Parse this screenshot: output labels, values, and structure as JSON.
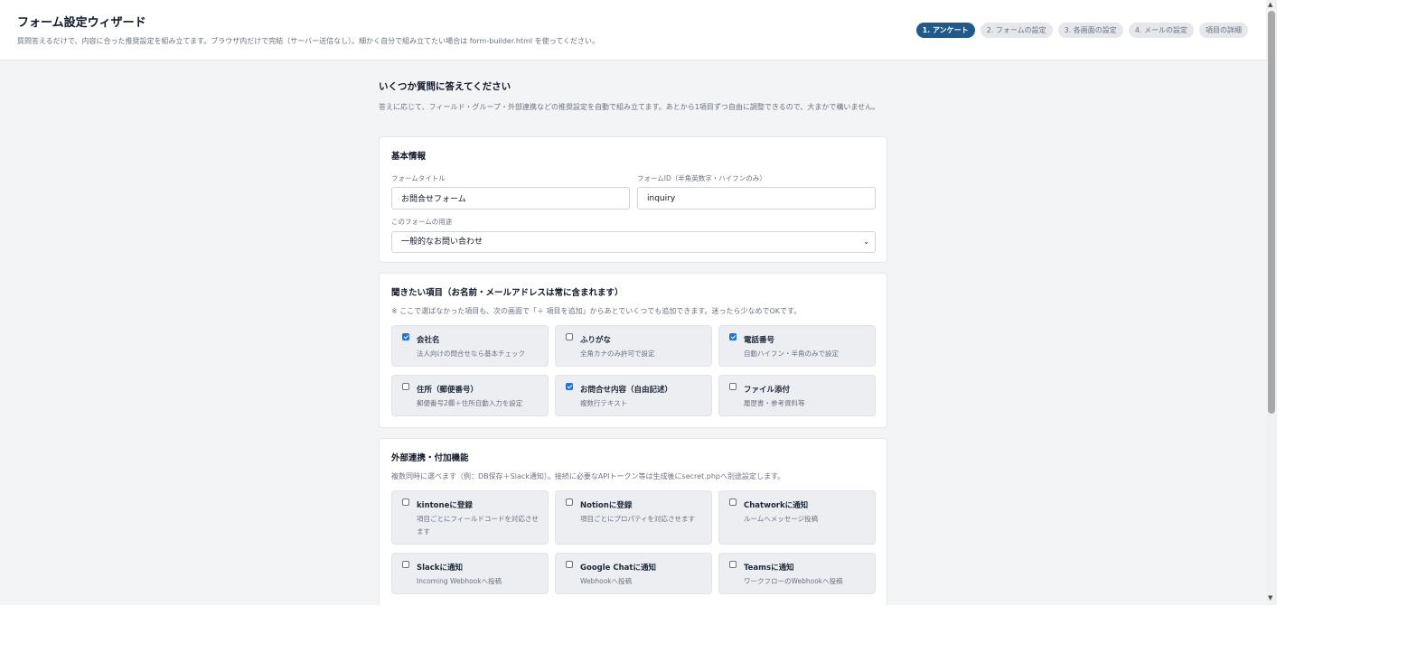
{
  "header": {
    "title": "フォーム設定ウィザード",
    "description": "質問答えるだけで、内容に合った推奨設定を組み立てます。ブラウザ内だけで完結（サーバー送信なし）。細かく自分で組み立てたい場合は form-builder.html を使ってください。",
    "steps": [
      {
        "label": "1. アンケート",
        "active": true
      },
      {
        "label": "2. フォームの設定",
        "active": false
      },
      {
        "label": "3. 各画面の設定",
        "active": false
      },
      {
        "label": "4. メールの設定",
        "active": false
      },
      {
        "label": "項目の詳細",
        "active": false
      }
    ]
  },
  "intro": {
    "title": "いくつか質問に答えてください",
    "description": "答えに応じて、フィールド・グループ・外部連携などの推奨設定を自動で組み立てます。あとから1項目ずつ自由に調整できるので、大まかで構いません。"
  },
  "basic": {
    "title": "基本情報",
    "form_title_label": "フォームタイトル",
    "form_title_value": "お問合せフォーム",
    "form_id_label": "フォームID（半角英数字・ハイフンのみ）",
    "form_id_value": "inquiry",
    "purpose_label": "このフォームの用途",
    "purpose_value": "一般的なお問い合わせ"
  },
  "fields": {
    "title": "聞きたい項目（お名前・メールアドレスは常に含まれます）",
    "note": "※ ここで選ばなかった項目も、次の画面で「＋ 項目を追加」からあとでいくつでも追加できます。迷ったら少なめでOKです。",
    "options": [
      {
        "label": "会社名",
        "sub": "法人向けの問合せなら基本チェック",
        "checked": true
      },
      {
        "label": "ふりがな",
        "sub": "全角カナのみ許可で設定",
        "checked": false
      },
      {
        "label": "電話番号",
        "sub": "自動ハイフン・半角のみで設定",
        "checked": true
      },
      {
        "label": "住所（郵便番号）",
        "sub": "郵便番号2欄＋住所自動入力を設定",
        "checked": false
      },
      {
        "label": "お問合せ内容（自由記述）",
        "sub": "複数行テキスト",
        "checked": true
      },
      {
        "label": "ファイル添付",
        "sub": "履歴書・参考資料等",
        "checked": false
      }
    ]
  },
  "integrations": {
    "title": "外部連携・付加機能",
    "note": "複数同時に選べます（例：DB保存＋Slack通知）。接続に必要なAPIトークン等は生成後にsecret.phpへ別途設定します。",
    "options": [
      {
        "label": "kintoneに登録",
        "sub": "項目ごとにフィールドコードを対応させます",
        "checked": false
      },
      {
        "label": "Notionに登録",
        "sub": "項目ごとにプロパティを対応させます",
        "checked": false
      },
      {
        "label": "Chatworkに通知",
        "sub": "ルームへメッセージ投稿",
        "checked": false
      },
      {
        "label": "Slackに通知",
        "sub": "Incoming Webhookへ投稿",
        "checked": false
      },
      {
        "label": "Google Chatに通知",
        "sub": "Webhookへ投稿",
        "checked": false
      },
      {
        "label": "Teamsに通知",
        "sub": "ワークフローのWebhookへ投稿",
        "checked": false
      }
    ]
  },
  "icons": {
    "chevron": "chevron-down-icon",
    "scroll_up": "scroll-up-arrow-icon",
    "scroll_down": "scroll-down-arrow-icon",
    "checkbox_checked": "checkbox-checked-icon",
    "checkbox_unchecked": "checkbox-unchecked-icon"
  },
  "colors": {
    "accent": "#1e5a8c",
    "checkbox": "#1a73e8",
    "page_bg": "#f3f4f6"
  }
}
